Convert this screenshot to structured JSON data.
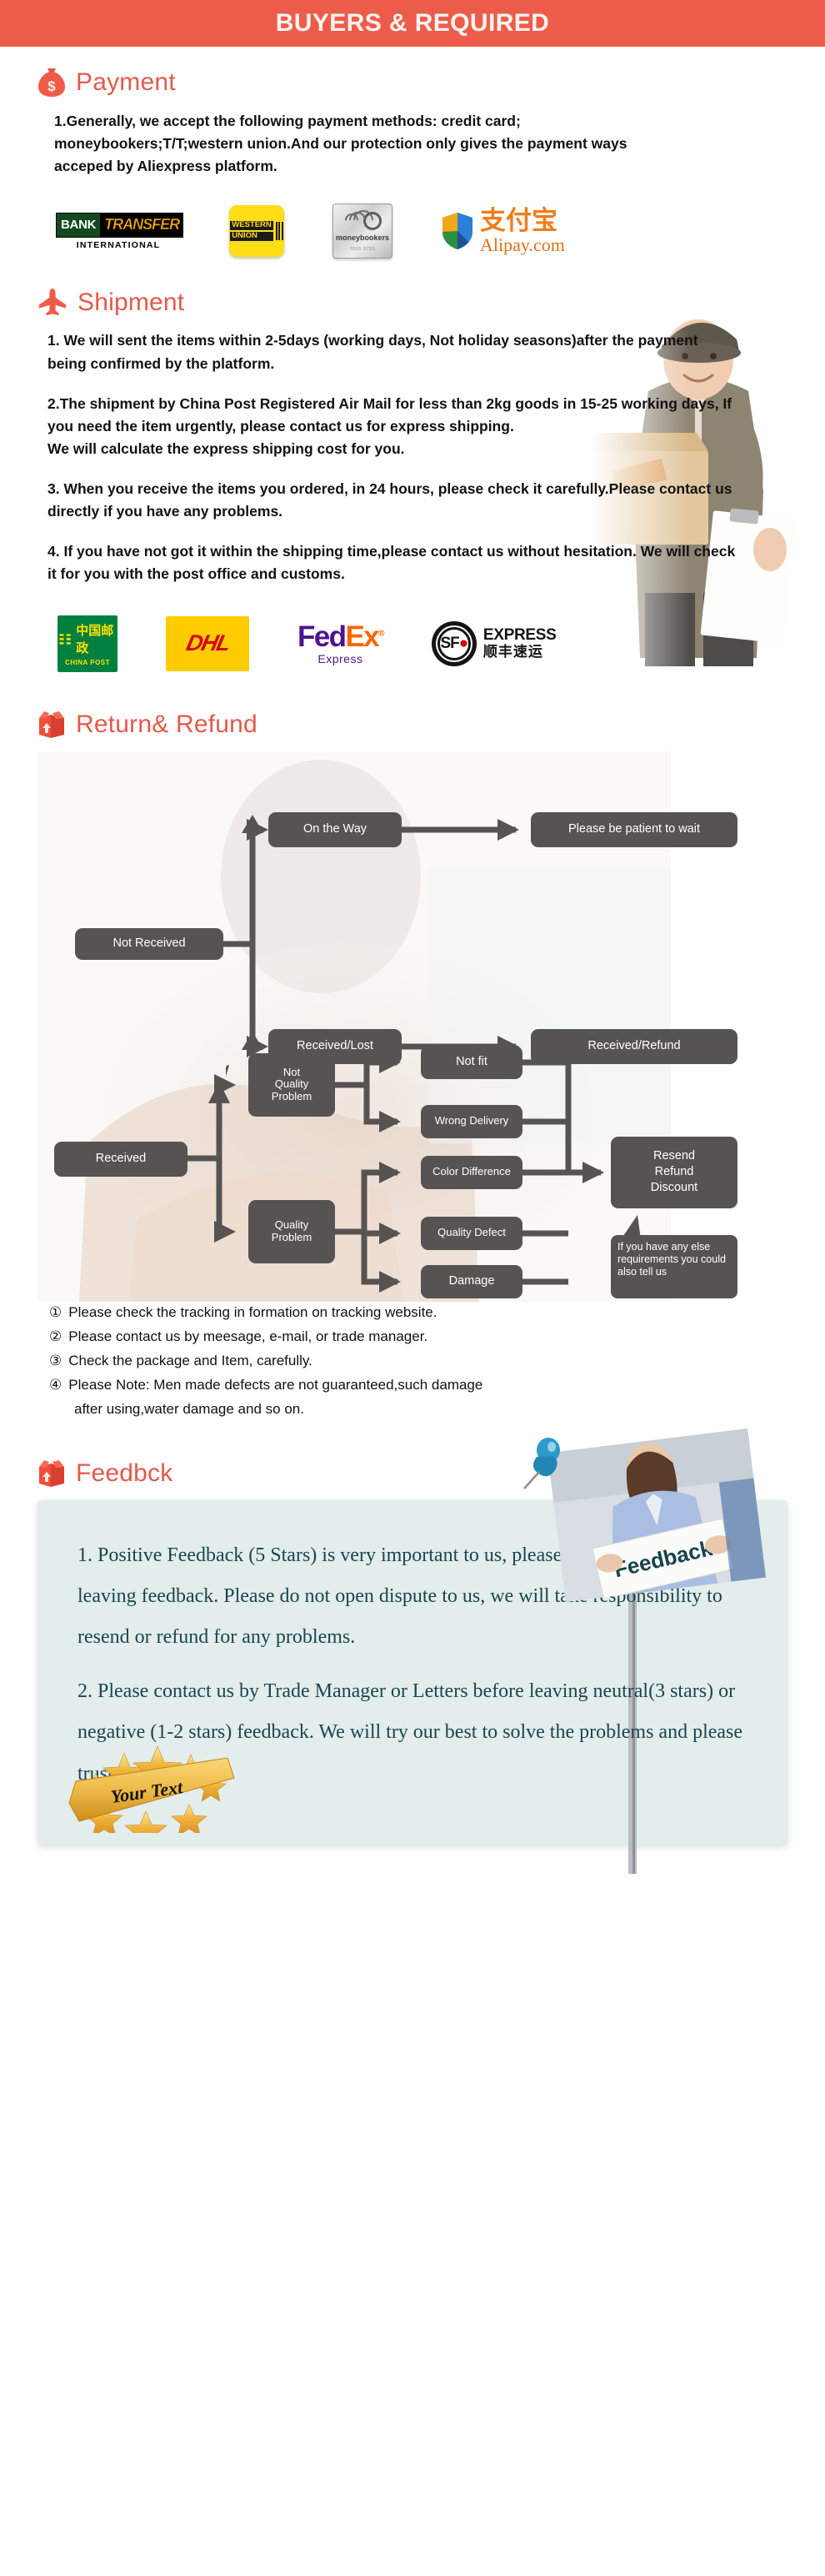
{
  "banner": {
    "title": "BUYERS & REQUIRED",
    "bg": "#ed5c4a",
    "text_color": "#fdf3f1"
  },
  "accent_color": "#e4594a",
  "sections": {
    "payment": {
      "icon": "money-bag-icon",
      "title": "Payment",
      "paragraphs": [
        "1.Generally, we accept the following payment methods: credit card; moneybookers;T/T;western union.And our protection only gives the payment ways acceped by Aliexpress platform."
      ],
      "logos": [
        {
          "name": "bank-transfer-logo",
          "primary": "BANK",
          "secondary": "TRANSFER",
          "sub": "INTERNATIONAL"
        },
        {
          "name": "western-union-logo",
          "line1": "WESTERN",
          "line2": "UNION"
        },
        {
          "name": "moneybookers-logo",
          "label": "moneybookers",
          "code": "7665 0793"
        },
        {
          "name": "alipay-logo",
          "cn": "支付宝",
          "en": "Alipay.com"
        }
      ]
    },
    "shipment": {
      "icon": "airplane-icon",
      "title": "Shipment",
      "paragraphs": [
        "1. We will sent the items within 2-5days (working days, Not holiday seasons)after the payment being confirmed by the platform.",
        "2.The shipment by China Post Registered Air Mail for less than  2kg goods in 15-25 working days, If  you need the item urgently, please contact us for express shipping.",
        "We will calculate the express shipping cost for you.",
        "3. When you receive the items you ordered, in 24 hours, please check  it carefully.Please contact us directly if you have any problems.",
        "4. If you have not got it within the shipping time,please contact us without hesitation. We will check it for you with the post office and customs."
      ],
      "photo_alt": "delivery-courier-photo",
      "logos": [
        {
          "name": "china-post-logo",
          "cn": "中国邮政",
          "en": "CHINA POST"
        },
        {
          "name": "dhl-logo",
          "text": "DHL"
        },
        {
          "name": "fedex-logo",
          "part1": "Fed",
          "part2": "Ex",
          "sub": "Express"
        },
        {
          "name": "sf-express-logo",
          "mark": "SF",
          "en": "EXPRESS",
          "cn": "顺丰速运"
        }
      ]
    },
    "return_refund": {
      "icon": "return-box-icon",
      "title": "Return& Refund",
      "photo_alt": "handshake-background-photo",
      "flow_nodes": [
        {
          "id": "not-received",
          "label": "Not Received"
        },
        {
          "id": "on-the-way",
          "label": "On the Way"
        },
        {
          "id": "please-wait",
          "label": "Please be patient to wait"
        },
        {
          "id": "received-lost",
          "label": "Received/Lost"
        },
        {
          "id": "received-refund",
          "label": "Received/Refund"
        },
        {
          "id": "received",
          "label": "Received"
        },
        {
          "id": "not-quality-problem",
          "label": "Not\nQuality\nProblem"
        },
        {
          "id": "quality-problem",
          "label": "Quality\nProblem"
        },
        {
          "id": "not-fit",
          "label": "Not fit"
        },
        {
          "id": "wrong-delivery",
          "label": "Wrong Delivery"
        },
        {
          "id": "color-difference",
          "label": "Color Difference"
        },
        {
          "id": "quality-defect",
          "label": "Quality Defect"
        },
        {
          "id": "damage",
          "label": "Damage"
        },
        {
          "id": "resend-refund-discount",
          "label": "Resend\nRefund\nDiscount"
        }
      ],
      "callout": "If you have any else requirements you could also tell us",
      "notes": [
        {
          "num": "①",
          "text": "Please check the tracking in formation on tracking website."
        },
        {
          "num": "②",
          "text": "Please contact us by meesage, e-mail, or trade manager."
        },
        {
          "num": "③",
          "text": "Check the package and Item, carefully."
        },
        {
          "num": "④",
          "text": "Please Note: Men made defects  are not guaranteed,such damage"
        }
      ],
      "notes_continuation": "after using,water damage and so on."
    },
    "feedback": {
      "icon": "return-box-icon",
      "title": "Feedbck",
      "photo_alt": "woman-holding-feedback-sign-photo",
      "photo_sign_text": "Feedback",
      "box_bg": "#e2edec",
      "text_color": "#1c4550",
      "paragraphs": [
        "1. Positive Feedback (5 Stars) is very important to us, please think twice before leaving feedback. Please do not open dispute to us,   we will take responsibility to resend or refund for any problems.",
        "2. Please contact us by Trade Manager or Letters before leaving neutral(3 stars) or negative (1-2 stars) feedback. We will try our best to solve the problems and please trust us"
      ],
      "badge": {
        "name": "gold-stars-ribbon-badge",
        "text": "Your Text"
      }
    }
  }
}
